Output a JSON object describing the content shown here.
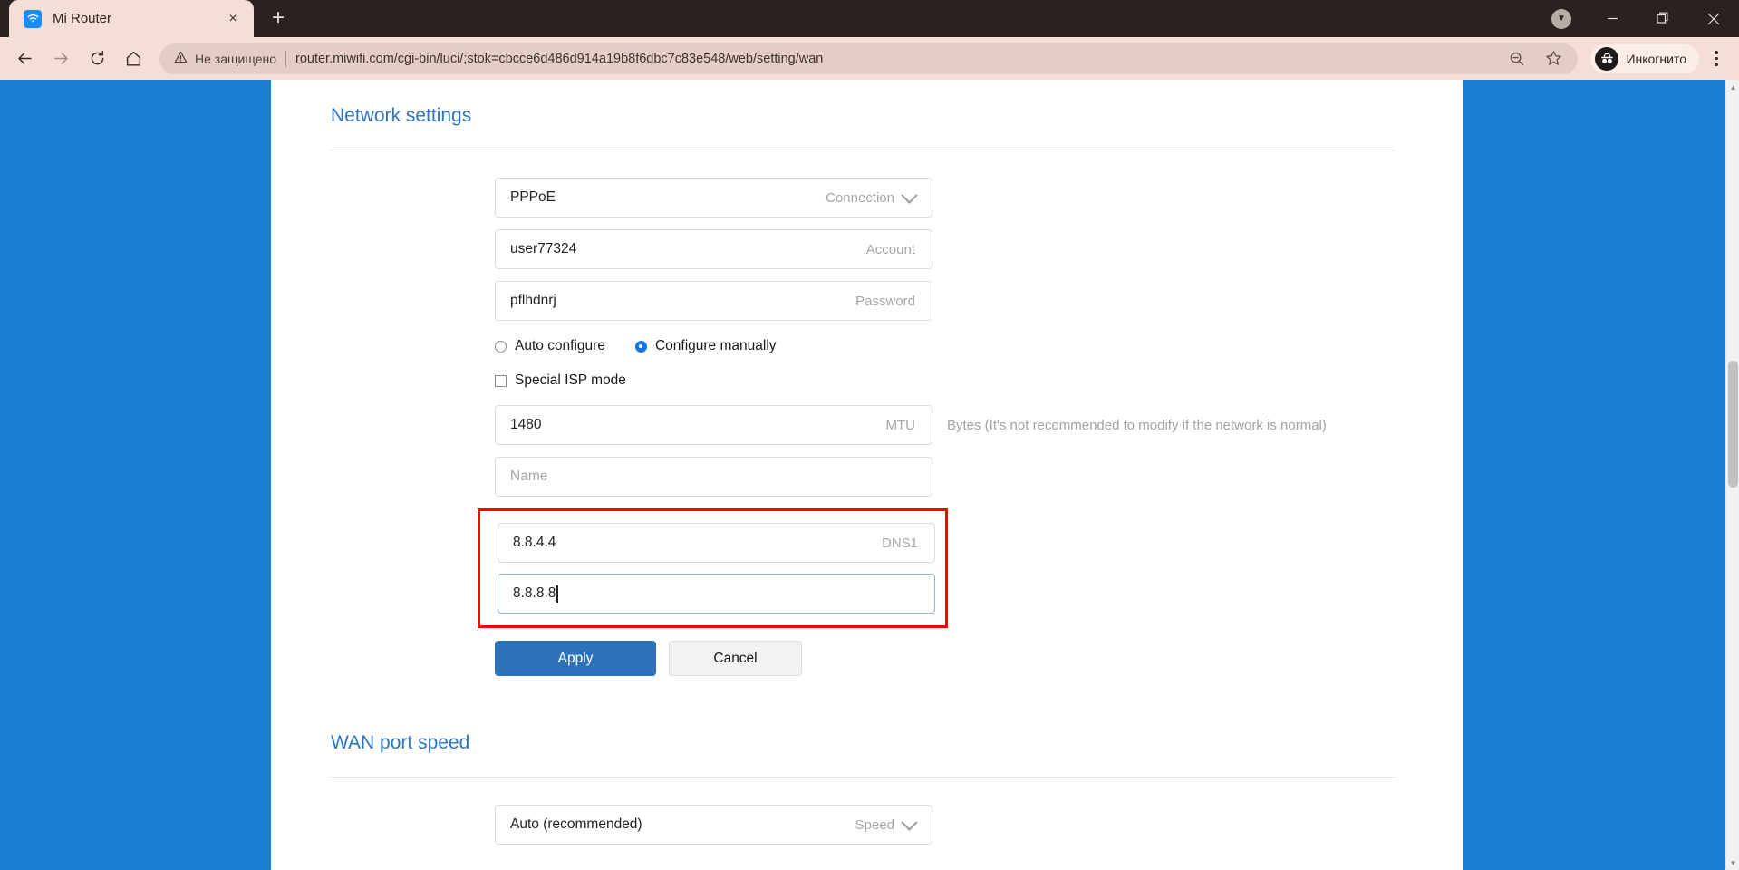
{
  "browser": {
    "tab": {
      "title": "Mi Router",
      "favicon": "wifi-icon",
      "close": "×"
    },
    "newtab_label": "+",
    "window_controls": {
      "update": "update-available-icon",
      "minimize": "—",
      "restore": "❐",
      "close": "✕"
    },
    "nav": {
      "back": "←",
      "forward": "→",
      "reload": "⟳",
      "home": "⌂"
    },
    "omnibox": {
      "security_label": "Не защищено",
      "warning_icon": "warning-triangle-icon",
      "url": "router.miwifi.com/cgi-bin/luci/;stok=cbcce6d486d914a19b8f6dbc7c83e548/web/setting/wan",
      "zoom_icon": "zoom-out-icon",
      "bookmark_icon": "star-icon"
    },
    "incognito": {
      "label": "Инкогнито",
      "icon": "incognito-icon"
    },
    "menu_icon": "three-dots-menu-icon"
  },
  "page": {
    "network_settings": {
      "title": "Network settings",
      "connection": {
        "value": "PPPoE",
        "label": "Connection",
        "chevron": "chevron-down-icon"
      },
      "account": {
        "value": "user77324",
        "label": "Account"
      },
      "password": {
        "value": "pflhdnrj",
        "label": "Password"
      },
      "config_mode": {
        "auto": {
          "label": "Auto configure",
          "selected": false
        },
        "manual": {
          "label": "Configure manually",
          "selected": true
        }
      },
      "special_isp": {
        "label": "Special ISP mode",
        "checked": false
      },
      "mtu": {
        "value": "1480",
        "label": "MTU",
        "hint": "Bytes (It's not recommended to modify if the network is normal)"
      },
      "name": {
        "value": "",
        "placeholder": "Name"
      },
      "dns1": {
        "value": "8.8.4.4",
        "label": "DNS1"
      },
      "dns2": {
        "value": "8.8.8.8",
        "label": "",
        "focused": true
      },
      "apply_label": "Apply",
      "cancel_label": "Cancel"
    },
    "wan_port_speed": {
      "title": "WAN port speed",
      "speed": {
        "value": "Auto (recommended)",
        "label": "Speed",
        "chevron": "chevron-down-icon"
      }
    }
  },
  "colors": {
    "accent_blue": "#2f76bd",
    "primary_button": "#2d72b8",
    "highlight_red": "#ff0000",
    "page_side": "#1a7fd4",
    "radio_on": "#1a73e8"
  }
}
